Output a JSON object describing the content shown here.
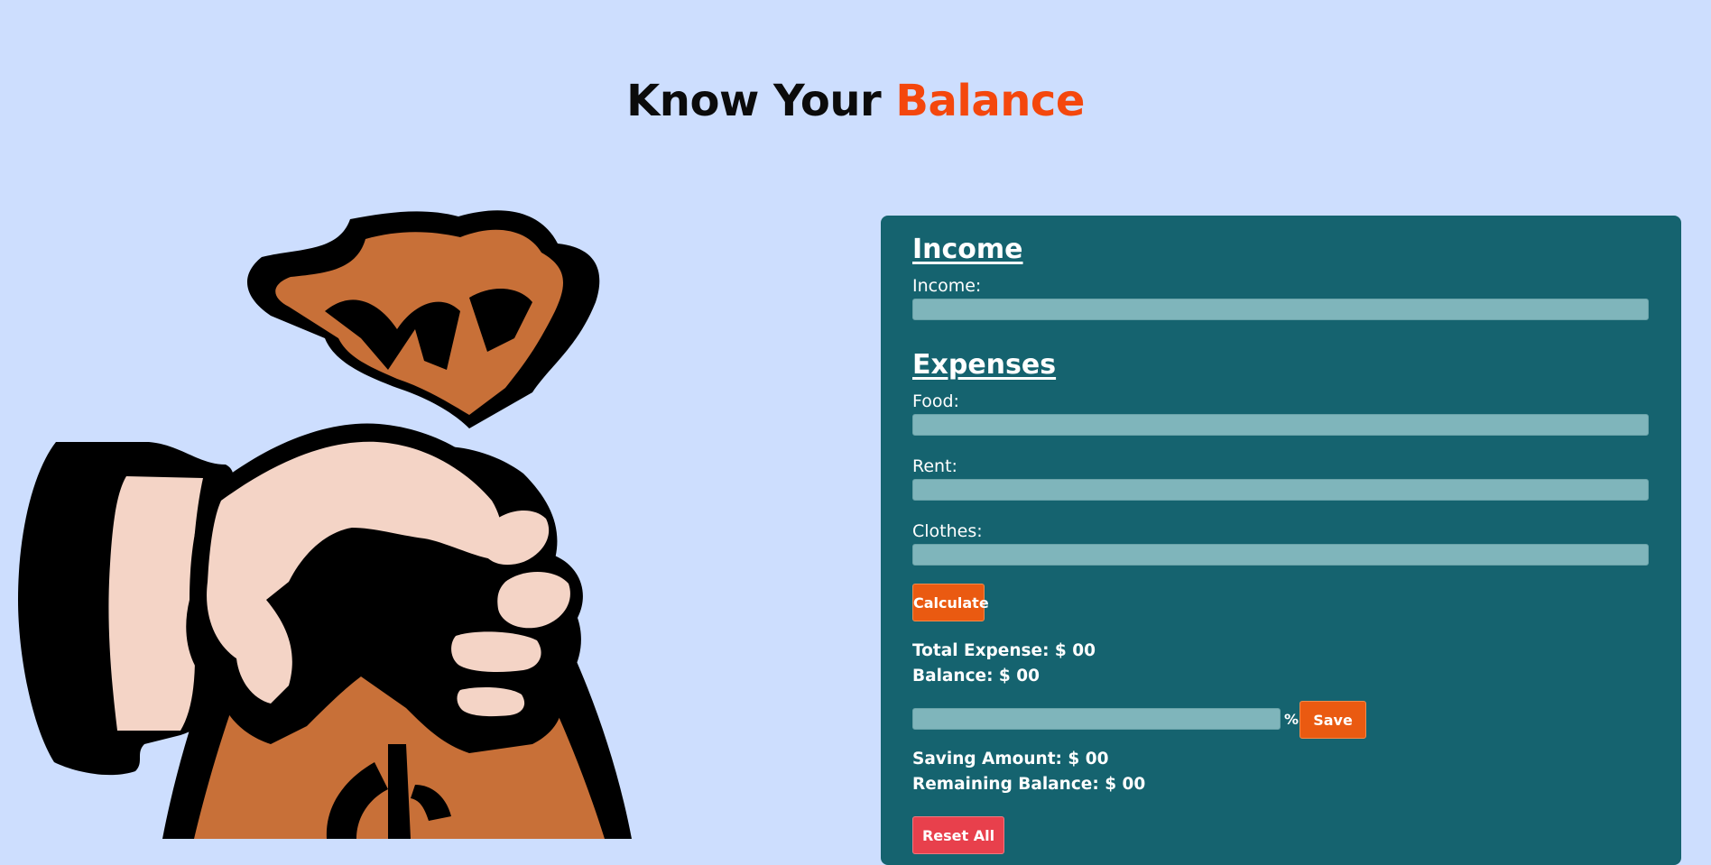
{
  "title": {
    "part1": "Know Your",
    "part2": "Balance"
  },
  "income_section": {
    "heading": "Income",
    "income_label": "Income:",
    "income_value": ""
  },
  "expenses_section": {
    "heading": "Expenses",
    "food_label": "Food:",
    "food_value": "",
    "rent_label": "Rent:",
    "rent_value": "",
    "clothes_label": "Clothes:",
    "clothes_value": ""
  },
  "calculate_label": "Calculate",
  "results": {
    "total_expense": "Total Expense: $ 00",
    "balance": "Balance: $ 00"
  },
  "saving": {
    "percent_value": "",
    "percent_sign": "%",
    "save_label": "Save",
    "saving_amount": "Saving Amount: $ 00",
    "remaining_balance": "Remaining Balance: $ 00"
  },
  "reset_label": "Reset All",
  "colors": {
    "background": "#cddefe",
    "accent": "#f4470d",
    "panel": "#15636f",
    "input": "#7fb5bb",
    "button": "#ea5a11",
    "reset_button": "#e8404c",
    "bag": "#c87038",
    "hand": "#f4d4c6"
  },
  "illustration": {
    "icon": "money-bag-hand-icon"
  }
}
